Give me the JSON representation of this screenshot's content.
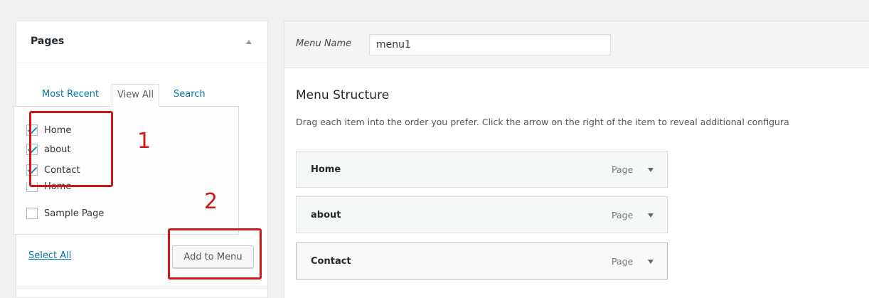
{
  "pages_panel": {
    "title": "Pages",
    "tabs": [
      {
        "label": "Most Recent"
      },
      {
        "label": "View All",
        "active": true
      },
      {
        "label": "Search"
      }
    ],
    "items": [
      {
        "label": "Home",
        "checked": true
      },
      {
        "label": "about",
        "checked": true
      },
      {
        "label": "Contact",
        "checked": true
      },
      {
        "label": "Home",
        "checked": false
      },
      {
        "label": "Sample Page",
        "checked": false
      }
    ],
    "select_all_label": "Select All",
    "add_button_label": "Add to Menu"
  },
  "annotations": {
    "marker_1": "1",
    "marker_2": "2",
    "color": "#cc1a1a"
  },
  "menu": {
    "name_label": "Menu Name",
    "name_value": "menu1",
    "structure_title": "Menu Structure",
    "structure_description": "Drag each item into the order you prefer. Click the arrow on the right of the item to reveal additional configura",
    "items": [
      {
        "title": "Home",
        "type": "Page"
      },
      {
        "title": "about",
        "type": "Page"
      },
      {
        "title": "Contact",
        "type": "Page"
      }
    ]
  },
  "colors": {
    "link": "#0073aa",
    "background": "#f1f1f1",
    "checkmark": "#1e8cbe"
  },
  "icons": {
    "collapse": "triangle-up-icon",
    "checkbox_check": "checkmark-icon",
    "menu_item_expand": "triangle-down-icon"
  }
}
